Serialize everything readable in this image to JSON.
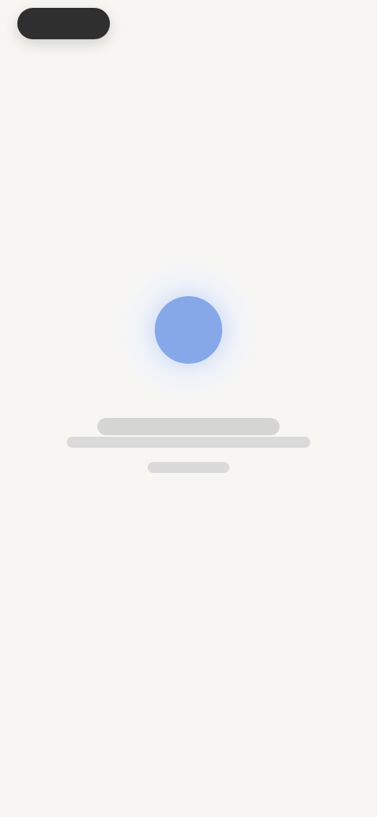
{
  "ui": {
    "title": "",
    "subtitle": ""
  },
  "colors": {
    "background": "#f7f6f2",
    "pill": "#2f2f2f",
    "accent_circle": "#86a8e8"
  },
  "icons": {
    "center": "circle-icon"
  }
}
